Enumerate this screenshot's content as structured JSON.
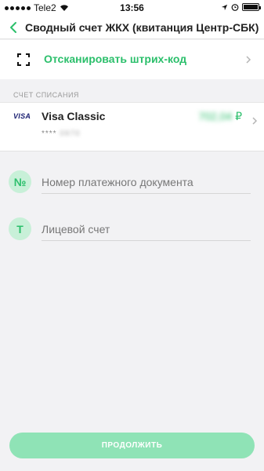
{
  "status_bar": {
    "carrier": "Tele2",
    "time": "13:56"
  },
  "header": {
    "title": "Сводный счет ЖКХ (квитанция Центр-СБК)"
  },
  "scan": {
    "label": "Отсканировать штрих-код"
  },
  "account_section": {
    "label": "СЧЕТ СПИСАНИЯ",
    "card": {
      "brand": "VISA",
      "name": "Visa Classic",
      "mask_prefix": "****",
      "mask_suffix": "0970",
      "balance": "702,04",
      "currency": "₽"
    }
  },
  "form": {
    "fields": [
      {
        "icon_label": "№",
        "placeholder": "Номер платежного документа",
        "value": ""
      },
      {
        "icon_label": "Т",
        "placeholder": "Лицевой счет",
        "value": ""
      }
    ]
  },
  "actions": {
    "continue_label": "ПРОДОЛЖИТЬ"
  },
  "colors": {
    "accent": "#2bbf6b",
    "accent_light": "#c8f0d8",
    "button_disabled": "#8fe3b6",
    "background": "#f2f2f4"
  },
  "icons": {
    "back": "chevron-left-icon",
    "scan": "barcode-scan-icon",
    "chevron": "chevron-right-icon",
    "wifi": "wifi-icon",
    "location": "location-arrow-icon",
    "alarm": "alarm-icon",
    "battery": "battery-icon"
  }
}
